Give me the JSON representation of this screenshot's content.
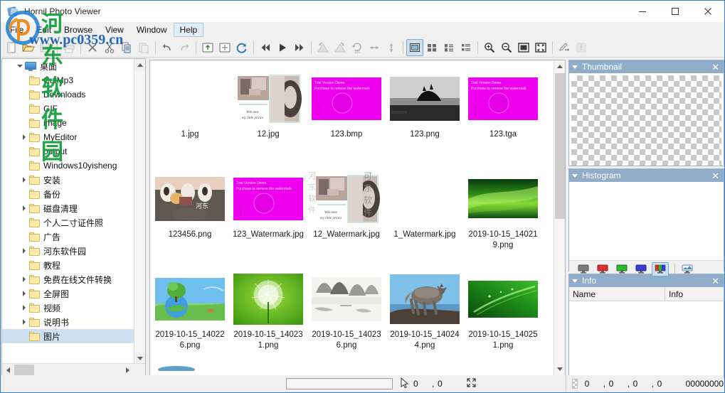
{
  "window": {
    "title": "Hornil Photo Viewer",
    "icon": "app-icon",
    "minimize_label": "—",
    "maximize_label": "□",
    "close_label": "✕"
  },
  "watermark": {
    "chinese": "河东软件园",
    "url": "www.pc0359.cn",
    "overlay_text_1": "可东软件",
    "overlay_text_2": "河东软件"
  },
  "menubar": {
    "items": [
      {
        "label": "File",
        "active": false
      },
      {
        "label": "Edit",
        "active": false
      },
      {
        "label": "Browse",
        "active": false
      },
      {
        "label": "View",
        "active": false
      },
      {
        "label": "Window",
        "active": false
      },
      {
        "label": "Help",
        "active": true
      }
    ]
  },
  "toolbar": {
    "groups": [
      {
        "buttons": [
          {
            "name": "new-icon",
            "enabled": true
          },
          {
            "name": "open-folder-icon",
            "enabled": true
          },
          {
            "name": "save-icon",
            "enabled": false
          }
        ]
      },
      {
        "buttons": [
          {
            "name": "print-icon",
            "enabled": false
          }
        ]
      },
      {
        "buttons": [
          {
            "name": "delete-icon",
            "enabled": true
          },
          {
            "name": "cut-icon",
            "enabled": true
          },
          {
            "name": "copy-icon",
            "enabled": true
          },
          {
            "name": "paste-icon",
            "enabled": false
          }
        ]
      },
      {
        "buttons": [
          {
            "name": "undo-icon",
            "enabled": true
          },
          {
            "name": "redo-icon",
            "enabled": false
          }
        ]
      },
      {
        "buttons": [
          {
            "name": "parent-folder-icon",
            "enabled": true
          },
          {
            "name": "new-folder-icon",
            "enabled": true
          },
          {
            "name": "refresh-icon",
            "enabled": true
          }
        ]
      },
      {
        "buttons": [
          {
            "name": "first-image-icon",
            "enabled": true
          },
          {
            "name": "play-slideshow-icon",
            "enabled": true
          },
          {
            "name": "last-image-icon",
            "enabled": true
          }
        ]
      },
      {
        "buttons": [
          {
            "name": "rotate-left-icon",
            "enabled": false
          },
          {
            "name": "rotate-right-icon",
            "enabled": false
          },
          {
            "name": "rotate-180-icon",
            "enabled": false
          },
          {
            "name": "flip-horizontal-icon",
            "enabled": false
          },
          {
            "name": "flip-vertical-icon",
            "enabled": false
          }
        ]
      },
      {
        "buttons": [
          {
            "name": "view-thumbnail-icon",
            "enabled": true,
            "selected": true
          },
          {
            "name": "view-tiles-icon",
            "enabled": true
          },
          {
            "name": "view-list-icon",
            "enabled": true
          },
          {
            "name": "view-details-icon",
            "enabled": true
          }
        ]
      },
      {
        "buttons": [
          {
            "name": "zoom-in-icon",
            "enabled": true
          },
          {
            "name": "zoom-out-icon",
            "enabled": true
          },
          {
            "name": "fit-to-window-icon",
            "enabled": true
          },
          {
            "name": "full-screen-icon",
            "enabled": true
          }
        ]
      },
      {
        "buttons": [
          {
            "name": "edit-image-icon",
            "enabled": true
          },
          {
            "name": "share-facebook-icon",
            "enabled": false
          }
        ]
      }
    ]
  },
  "tree": {
    "root": {
      "label": "桌面",
      "icon": "desktop-icon",
      "expanded": true,
      "selected": false
    },
    "items": [
      {
        "label": "CutMp3",
        "expandable": false,
        "selected": false
      },
      {
        "label": "Downloads",
        "expandable": false,
        "selected": false
      },
      {
        "label": "GIF",
        "expandable": false,
        "selected": false
      },
      {
        "label": "image",
        "expandable": false,
        "selected": false
      },
      {
        "label": "MyEditor",
        "expandable": true,
        "selected": false
      },
      {
        "label": "output",
        "expandable": false,
        "selected": false
      },
      {
        "label": "Windows10yisheng",
        "expandable": false,
        "selected": false
      },
      {
        "label": "安装",
        "expandable": true,
        "selected": false
      },
      {
        "label": "备份",
        "expandable": false,
        "selected": false
      },
      {
        "label": "磁盘清理",
        "expandable": true,
        "selected": false
      },
      {
        "label": "个人二寸证件照",
        "expandable": false,
        "selected": false
      },
      {
        "label": "广告",
        "expandable": false,
        "selected": false
      },
      {
        "label": "河东软件园",
        "expandable": true,
        "selected": false
      },
      {
        "label": "教程",
        "expandable": false,
        "selected": false
      },
      {
        "label": "免费在线文件转换",
        "expandable": true,
        "selected": false
      },
      {
        "label": "全屏图",
        "expandable": true,
        "selected": false
      },
      {
        "label": "视频",
        "expandable": true,
        "selected": false
      },
      {
        "label": "说明书",
        "expandable": true,
        "selected": false
      },
      {
        "label": "图片",
        "expandable": false,
        "selected": true
      }
    ]
  },
  "browser": {
    "rows": [
      [
        {
          "name": "1.jpg",
          "art": "collage",
          "selected": false
        },
        {
          "name": "12.jpg",
          "art": "collage",
          "selected": true
        },
        {
          "name": "123.bmp",
          "art": "magenta",
          "selected": false
        },
        {
          "name": "123.png",
          "art": "bw-island",
          "selected": false
        },
        {
          "name": "123.tga",
          "art": "magenta",
          "selected": false
        }
      ],
      [
        {
          "name": "123456.png",
          "art": "cows",
          "selected": false
        },
        {
          "name": "123_Watermark.jpg",
          "art": "magenta",
          "selected": false
        },
        {
          "name": "12_Watermark.jpg",
          "art": "collage",
          "selected": false
        },
        {
          "name": "1_Watermark.jpg",
          "art": "blank",
          "selected": false
        },
        {
          "name": "2019-10-15_140219.png",
          "art": "green-wave",
          "selected": false
        }
      ],
      [
        {
          "name": "2019-10-15_140226.png",
          "art": "earth-tree",
          "selected": false
        },
        {
          "name": "2019-10-15_140231.png",
          "art": "dandelion",
          "selected": false
        },
        {
          "name": "2019-10-15_140236.png",
          "art": "ink-landscape",
          "selected": false
        },
        {
          "name": "2019-10-15_140244.png",
          "art": "wolf",
          "selected": false
        },
        {
          "name": "2019-10-15_140251.png",
          "art": "green-light",
          "selected": false
        }
      ]
    ],
    "watermark_text": "Trial Version Demo.\nPurchase to remove the watermark"
  },
  "dock": {
    "panels": [
      {
        "id": "thumbnail",
        "title": "Thumbnail",
        "close_label": "✕"
      },
      {
        "id": "histogram",
        "title": "Histogram",
        "close_label": "✕"
      },
      {
        "id": "info",
        "title": "Info",
        "close_label": "✕"
      }
    ],
    "histogram_channels": [
      {
        "name": "channel-gray",
        "color": "#7b7b7b",
        "selected": false
      },
      {
        "name": "channel-red",
        "color": "#e03030",
        "selected": false
      },
      {
        "name": "channel-green",
        "color": "#2eb82e",
        "selected": false
      },
      {
        "name": "channel-blue",
        "color": "#3b3bd6",
        "selected": false
      },
      {
        "name": "channel-rgb",
        "color": "#e03030",
        "selected": true
      },
      {
        "name": "channel-luminance",
        "color": "#4a8fbf",
        "selected": false
      }
    ],
    "info_columns": [
      "Name",
      "Info"
    ]
  },
  "statusbar": {
    "field_value": "",
    "cursor_icon": "mouse-pointer-icon",
    "cursor_x": "0",
    "cursor_sep": ",",
    "cursor_y": "0",
    "expand_icon": "expand-icon",
    "color_r": "0",
    "color_g": "0",
    "color_b": "0",
    "color_a": "0",
    "color_hex": "00000000"
  },
  "colors": {
    "accent": "#8fadc8",
    "selection": "#cde0f2",
    "toolbar_bg": "#f0f0f0",
    "magenta": "#ef00ef"
  }
}
